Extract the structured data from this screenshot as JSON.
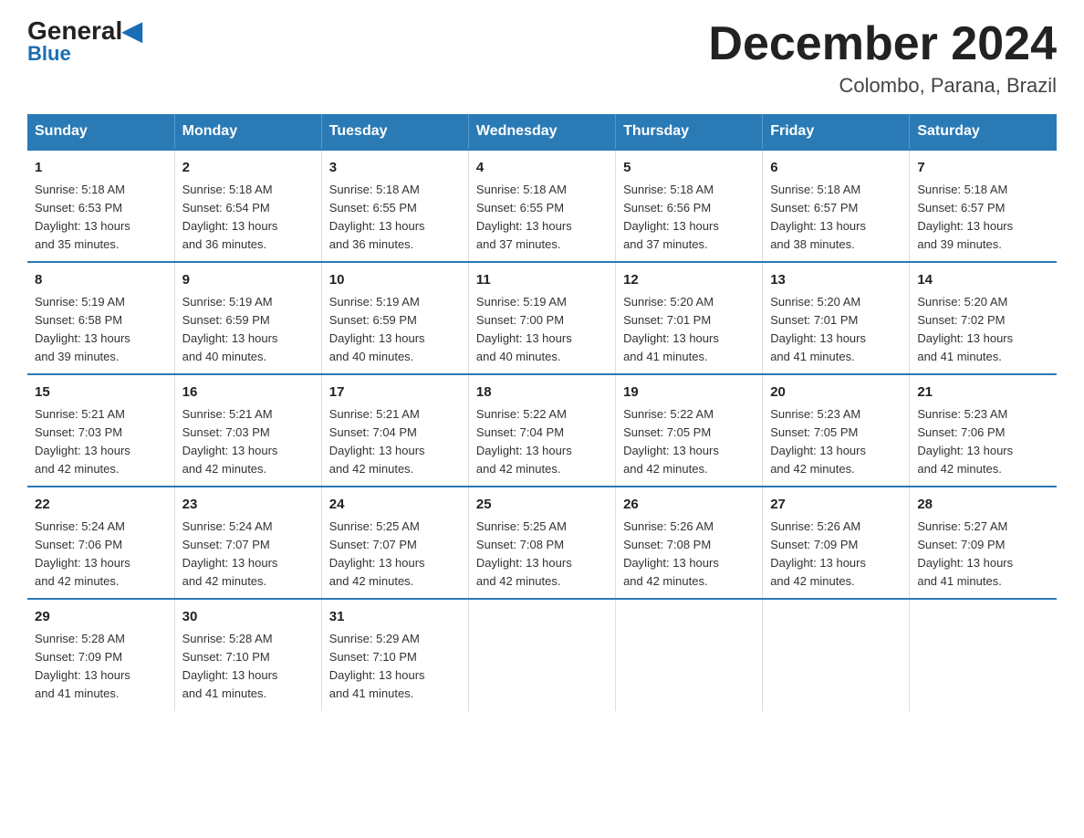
{
  "logo": {
    "name_part1": "General",
    "name_part2": "Blue"
  },
  "title": "December 2024",
  "subtitle": "Colombo, Parana, Brazil",
  "headers": [
    "Sunday",
    "Monday",
    "Tuesday",
    "Wednesday",
    "Thursday",
    "Friday",
    "Saturday"
  ],
  "weeks": [
    [
      {
        "day": "1",
        "info": "Sunrise: 5:18 AM\nSunset: 6:53 PM\nDaylight: 13 hours\nand 35 minutes."
      },
      {
        "day": "2",
        "info": "Sunrise: 5:18 AM\nSunset: 6:54 PM\nDaylight: 13 hours\nand 36 minutes."
      },
      {
        "day": "3",
        "info": "Sunrise: 5:18 AM\nSunset: 6:55 PM\nDaylight: 13 hours\nand 36 minutes."
      },
      {
        "day": "4",
        "info": "Sunrise: 5:18 AM\nSunset: 6:55 PM\nDaylight: 13 hours\nand 37 minutes."
      },
      {
        "day": "5",
        "info": "Sunrise: 5:18 AM\nSunset: 6:56 PM\nDaylight: 13 hours\nand 37 minutes."
      },
      {
        "day": "6",
        "info": "Sunrise: 5:18 AM\nSunset: 6:57 PM\nDaylight: 13 hours\nand 38 minutes."
      },
      {
        "day": "7",
        "info": "Sunrise: 5:18 AM\nSunset: 6:57 PM\nDaylight: 13 hours\nand 39 minutes."
      }
    ],
    [
      {
        "day": "8",
        "info": "Sunrise: 5:19 AM\nSunset: 6:58 PM\nDaylight: 13 hours\nand 39 minutes."
      },
      {
        "day": "9",
        "info": "Sunrise: 5:19 AM\nSunset: 6:59 PM\nDaylight: 13 hours\nand 40 minutes."
      },
      {
        "day": "10",
        "info": "Sunrise: 5:19 AM\nSunset: 6:59 PM\nDaylight: 13 hours\nand 40 minutes."
      },
      {
        "day": "11",
        "info": "Sunrise: 5:19 AM\nSunset: 7:00 PM\nDaylight: 13 hours\nand 40 minutes."
      },
      {
        "day": "12",
        "info": "Sunrise: 5:20 AM\nSunset: 7:01 PM\nDaylight: 13 hours\nand 41 minutes."
      },
      {
        "day": "13",
        "info": "Sunrise: 5:20 AM\nSunset: 7:01 PM\nDaylight: 13 hours\nand 41 minutes."
      },
      {
        "day": "14",
        "info": "Sunrise: 5:20 AM\nSunset: 7:02 PM\nDaylight: 13 hours\nand 41 minutes."
      }
    ],
    [
      {
        "day": "15",
        "info": "Sunrise: 5:21 AM\nSunset: 7:03 PM\nDaylight: 13 hours\nand 42 minutes."
      },
      {
        "day": "16",
        "info": "Sunrise: 5:21 AM\nSunset: 7:03 PM\nDaylight: 13 hours\nand 42 minutes."
      },
      {
        "day": "17",
        "info": "Sunrise: 5:21 AM\nSunset: 7:04 PM\nDaylight: 13 hours\nand 42 minutes."
      },
      {
        "day": "18",
        "info": "Sunrise: 5:22 AM\nSunset: 7:04 PM\nDaylight: 13 hours\nand 42 minutes."
      },
      {
        "day": "19",
        "info": "Sunrise: 5:22 AM\nSunset: 7:05 PM\nDaylight: 13 hours\nand 42 minutes."
      },
      {
        "day": "20",
        "info": "Sunrise: 5:23 AM\nSunset: 7:05 PM\nDaylight: 13 hours\nand 42 minutes."
      },
      {
        "day": "21",
        "info": "Sunrise: 5:23 AM\nSunset: 7:06 PM\nDaylight: 13 hours\nand 42 minutes."
      }
    ],
    [
      {
        "day": "22",
        "info": "Sunrise: 5:24 AM\nSunset: 7:06 PM\nDaylight: 13 hours\nand 42 minutes."
      },
      {
        "day": "23",
        "info": "Sunrise: 5:24 AM\nSunset: 7:07 PM\nDaylight: 13 hours\nand 42 minutes."
      },
      {
        "day": "24",
        "info": "Sunrise: 5:25 AM\nSunset: 7:07 PM\nDaylight: 13 hours\nand 42 minutes."
      },
      {
        "day": "25",
        "info": "Sunrise: 5:25 AM\nSunset: 7:08 PM\nDaylight: 13 hours\nand 42 minutes."
      },
      {
        "day": "26",
        "info": "Sunrise: 5:26 AM\nSunset: 7:08 PM\nDaylight: 13 hours\nand 42 minutes."
      },
      {
        "day": "27",
        "info": "Sunrise: 5:26 AM\nSunset: 7:09 PM\nDaylight: 13 hours\nand 42 minutes."
      },
      {
        "day": "28",
        "info": "Sunrise: 5:27 AM\nSunset: 7:09 PM\nDaylight: 13 hours\nand 41 minutes."
      }
    ],
    [
      {
        "day": "29",
        "info": "Sunrise: 5:28 AM\nSunset: 7:09 PM\nDaylight: 13 hours\nand 41 minutes."
      },
      {
        "day": "30",
        "info": "Sunrise: 5:28 AM\nSunset: 7:10 PM\nDaylight: 13 hours\nand 41 minutes."
      },
      {
        "day": "31",
        "info": "Sunrise: 5:29 AM\nSunset: 7:10 PM\nDaylight: 13 hours\nand 41 minutes."
      },
      null,
      null,
      null,
      null
    ]
  ]
}
